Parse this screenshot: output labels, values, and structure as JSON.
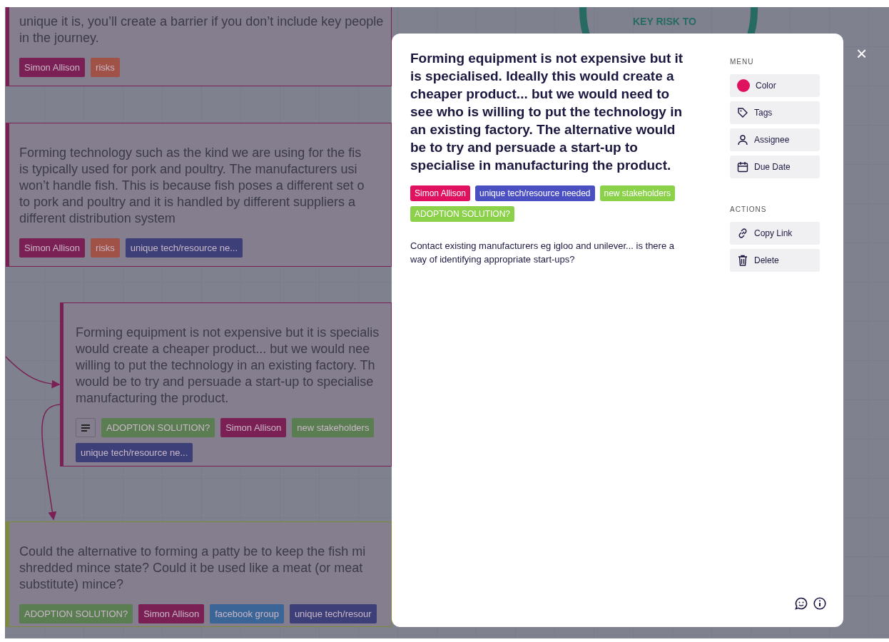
{
  "canvas": {
    "circle_label": "KEY RISK TO",
    "cards": [
      {
        "color": "#7a2055",
        "has_notes": false,
        "lines": [
          "unique it is, you’ll create a barrier if you don’t include key people",
          "in the journey."
        ],
        "tags": [
          {
            "label": "Simon Allison",
            "color": "#7a2055"
          },
          {
            "label": "risks",
            "color": "#a05246"
          }
        ]
      },
      {
        "color": "#7a2055",
        "has_notes": false,
        "lines": [
          "Forming technology such as the kind we are using for the fis",
          "is typically used for pork and poultry. The manufacturers usi",
          "won’t handle fish. This is because fish poses a different set o",
          "to pork and poultry and it is handled by different suppliers a",
          "different distribution system"
        ],
        "tags": [
          {
            "label": "Simon Allison",
            "color": "#7a2055"
          },
          {
            "label": "risks",
            "color": "#a05246"
          },
          {
            "label": "unique tech/resource ne...",
            "color": "#3d3f78"
          }
        ]
      },
      {
        "color": "#7a2055",
        "has_notes": true,
        "lines": [
          "Forming equipment is not expensive but it is specialis",
          "would create a cheaper product... but we would nee",
          "willing to put the technology in an existing factory. Th",
          "would be to try and persuade a start-up to specialise",
          "manufacturing the product."
        ],
        "tags": [
          {
            "label": "ADOPTION SOLUTION?",
            "color": "#5a7d52"
          },
          {
            "label": "Simon Allison",
            "color": "#7a2055"
          },
          {
            "label": "new stakeholders",
            "color": "#5a7d52"
          },
          {
            "label": "unique tech/resource ne...",
            "color": "#3d3f78"
          }
        ]
      },
      {
        "color": "#7d8a3a",
        "has_notes": false,
        "lines": [
          "Could the alternative to forming a patty be to keep the fish mi",
          "shredded mince state? Could it be used like a meat (or meat",
          "substitute) mince?"
        ],
        "tags": [
          {
            "label": "ADOPTION SOLUTION?",
            "color": "#5a7d52"
          },
          {
            "label": "Simon Allison",
            "color": "#7a2055"
          },
          {
            "label": "facebook group",
            "color": "#3a6596"
          },
          {
            "label": "unique tech/resour",
            "color": "#3d3f78"
          }
        ]
      }
    ]
  },
  "modal": {
    "title": "Forming equipment is not expensive but it is specialised. Ideally this would create a cheaper product... but we would need to see who is willing to put the technology in an existing factory. The alternative would be to try and persuade a start-up to specialise in manufacturing the product.",
    "tags": [
      {
        "label": "Simon Allison",
        "color": "#e0115f"
      },
      {
        "label": "unique tech/resource needed",
        "color": "#4a4fc2"
      },
      {
        "label": "new stakeholders",
        "color": "#8bd14a"
      },
      {
        "label": "ADOPTION SOLUTION?",
        "color": "#8bd14a"
      }
    ],
    "description": "Contact existing manufacturers eg igloo and unilever... is there a way of identifying appropriate start-ups?",
    "menu": {
      "heading": "MENU",
      "items": [
        {
          "kind": "color",
          "label": "Color",
          "color": "#e0115f"
        },
        {
          "kind": "tag",
          "label": "Tags"
        },
        {
          "kind": "person",
          "label": "Assignee"
        },
        {
          "kind": "calendar",
          "label": "Due Date"
        }
      ]
    },
    "actions": {
      "heading": "ACTIONS",
      "items": [
        {
          "kind": "link",
          "label": "Copy Link"
        },
        {
          "kind": "trash",
          "label": "Delete"
        }
      ]
    },
    "close_label": "×"
  }
}
